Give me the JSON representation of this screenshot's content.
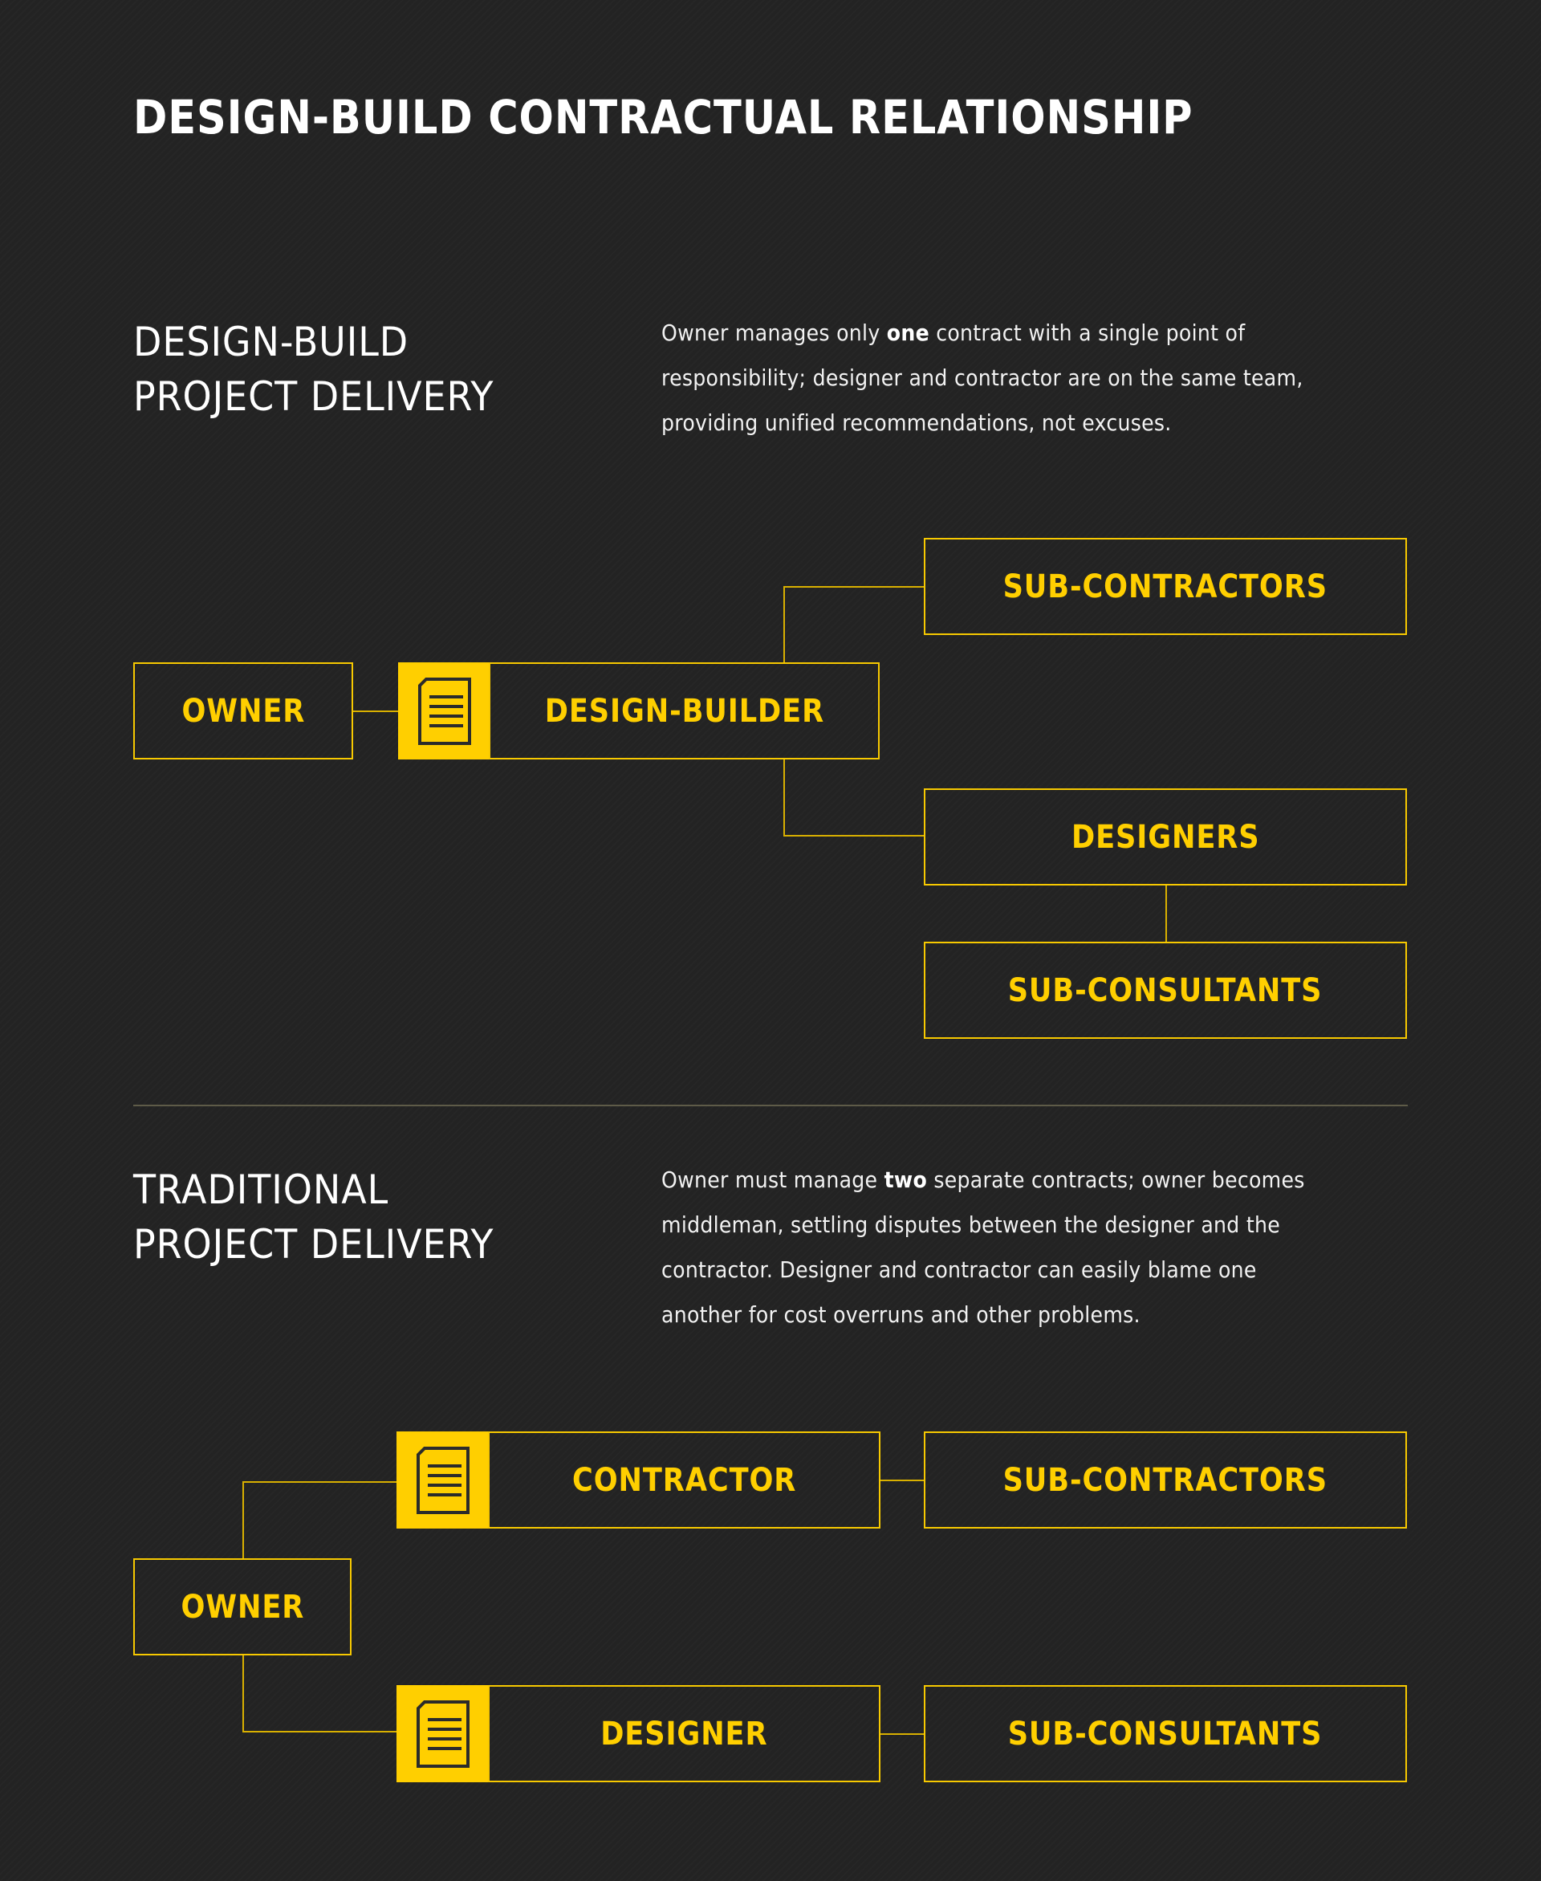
{
  "title": "DESIGN-BUILD CONTRACTUAL RELATIONSHIP",
  "colors": {
    "accent": "#ffcf00",
    "background": "#232323",
    "text": "#ffffff",
    "divider": "#5e5b48"
  },
  "design_build": {
    "heading": [
      "DESIGN-BUILD",
      "PROJECT DELIVERY"
    ],
    "description": {
      "lines": [
        {
          "before": "Owner manages only ",
          "bold": "one",
          "after": " contract with a single point of"
        },
        {
          "before": "responsibility; designer and contractor are on the same team,",
          "bold": "",
          "after": ""
        },
        {
          "before": "providing unified recommendations, not excuses.",
          "bold": "",
          "after": ""
        }
      ]
    },
    "nodes": {
      "owner": "OWNER",
      "design_builder": "DESIGN-BUILDER",
      "sub_contractors": "SUB-CONTRACTORS",
      "designers": "DESIGNERS",
      "sub_consultants": "SUB-CONSULTANTS"
    },
    "contract_icon": "document-icon"
  },
  "traditional": {
    "heading": [
      "TRADITIONAL",
      "PROJECT DELIVERY"
    ],
    "description": {
      "lines": [
        {
          "before": "Owner must manage ",
          "bold": "two",
          "after": " separate contracts; owner becomes"
        },
        {
          "before": "middleman, settling disputes between the designer and the",
          "bold": "",
          "after": ""
        },
        {
          "before": "contractor. Designer and contractor can easily blame one",
          "bold": "",
          "after": ""
        },
        {
          "before": "another for cost overruns and other problems.",
          "bold": "",
          "after": ""
        }
      ]
    },
    "nodes": {
      "owner": "OWNER",
      "contractor": "CONTRACTOR",
      "designer": "DESIGNER",
      "sub_contractors": "SUB-CONTRACTORS",
      "sub_consultants": "SUB-CONSULTANTS"
    },
    "contract_icon": "document-icon"
  }
}
